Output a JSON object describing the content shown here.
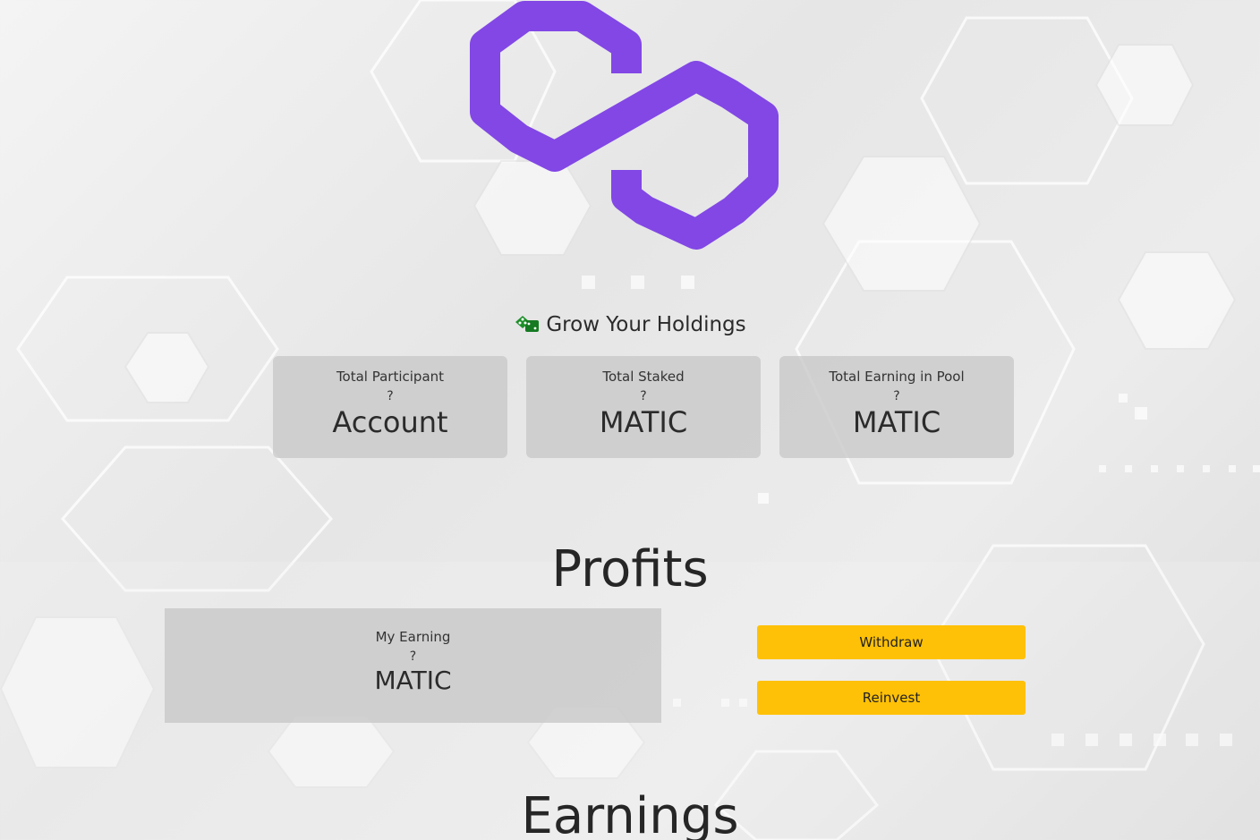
{
  "colors": {
    "brand_purple": "#8247e5",
    "button_yellow": "#ffc107",
    "dice_green": "#1f8f2a",
    "card_gray": "#cfcfcf"
  },
  "icons": {
    "logo": "polygon-matic-logo",
    "grow": "dice-icon"
  },
  "header": {
    "grow_title": "Grow Your Holdings"
  },
  "stats": [
    {
      "label": "Total Participant",
      "value": "?",
      "unit": "Account"
    },
    {
      "label": "Total Staked",
      "value": "?",
      "unit": "MATIC"
    },
    {
      "label": "Total Earning in Pool",
      "value": "?",
      "unit": "MATIC"
    }
  ],
  "profits": {
    "title": "Profits",
    "my_earning_label": "My Earning",
    "my_earning_value": "?",
    "my_earning_unit": "MATIC",
    "withdraw_label": "Withdraw",
    "reinvest_label": "Reinvest"
  },
  "earnings": {
    "title": "Earnings"
  }
}
